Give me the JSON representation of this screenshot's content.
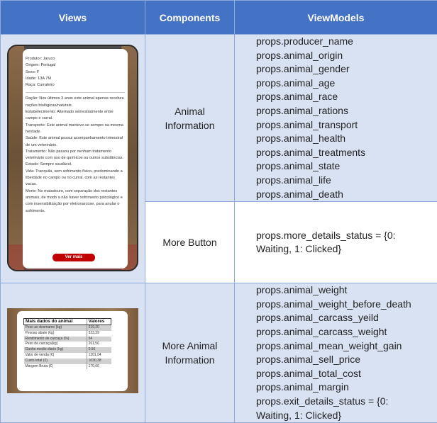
{
  "headers": {
    "views": "Views",
    "components": "Components",
    "viewmodels": "ViewModels"
  },
  "rows": [
    {
      "component": [
        "Animal",
        "Information"
      ],
      "viewmodels": [
        "props.producer_name",
        "props.animal_origin",
        "props.animal_gender",
        "props.animal_age",
        "props.animal_race",
        "props.animal_rations",
        "props.animal_transport",
        "props.animal_health",
        "props.animal_treatments",
        "props.animal_state",
        "props.animal_life",
        "props.animal_death"
      ]
    },
    {
      "component": [
        "More Button"
      ],
      "viewmodels_wrapped": "props.more_details_status = {0: Waiting, 1: Clicked}"
    },
    {
      "component": [
        "More Animal",
        "Information"
      ],
      "viewmodels": [
        "props.animal_weight",
        "props.animal_weight_before_death",
        "props.animal_carcass_yeild",
        "props.animal_carcass_weight",
        "props.animal_mean_weight_gain",
        "props.animal_sell_price",
        "props.animal_total_cost",
        "props.animal_margin"
      ],
      "viewmodels_wrapped": "props.exit_details_status = {0: Waiting, 1: Clicked}"
    }
  ],
  "screenshot1": {
    "info": [
      "Produtor: Jaruco",
      "Origem: Portugal",
      "Sexo: F",
      "Idade: 13A 7M",
      "Raça: Curraleiro"
    ],
    "details": [
      "Ração: Nos últimos 3 anos este animal apenas recebeu rações biológicas/naturais.",
      "Estabelecimento: Alternado semestralmente entre campo e curral.",
      "Transporte: Este animal manteve-se sempre na mesma herdade.",
      "Saúde: Este animal possui acompanhamento trimestral de um veterinário.",
      "Tratamento: Não passou por nenhum tratamento veterinário com uso de químicos ou outros substâncias.",
      "Estado: Sempre saudável.",
      "Vida: Tranquila, sem sofrimento físico, predominando a liberdade no campo ou no curral, com as restantes vacas.",
      "Morte: No matadouro, com separação dos restantes animais, de modo a não haver sofrimento psicológico e com insensibilização por eletronarcose, para anular o sofrimento."
    ],
    "button": "Ver mais"
  },
  "screenshot2": {
    "header": [
      "Mais dados do animal",
      "Valores"
    ],
    "rows": [
      [
        "Peso ao desmame (kg)",
        "219,20"
      ],
      [
        "Pesoao abate (kg)",
        "523,39"
      ],
      [
        "Rendimento de carcaça (%)",
        "54"
      ],
      [
        "Peso de carcaça(kg)",
        "261,56"
      ],
      [
        "Ganho medio diario (kg)",
        "0.56"
      ],
      [
        "Valor de venda (€)",
        "1201,04"
      ],
      [
        "Custo total (€)",
        "1030,38"
      ],
      [
        "Margem Bruta (€)",
        "170,66"
      ]
    ]
  }
}
